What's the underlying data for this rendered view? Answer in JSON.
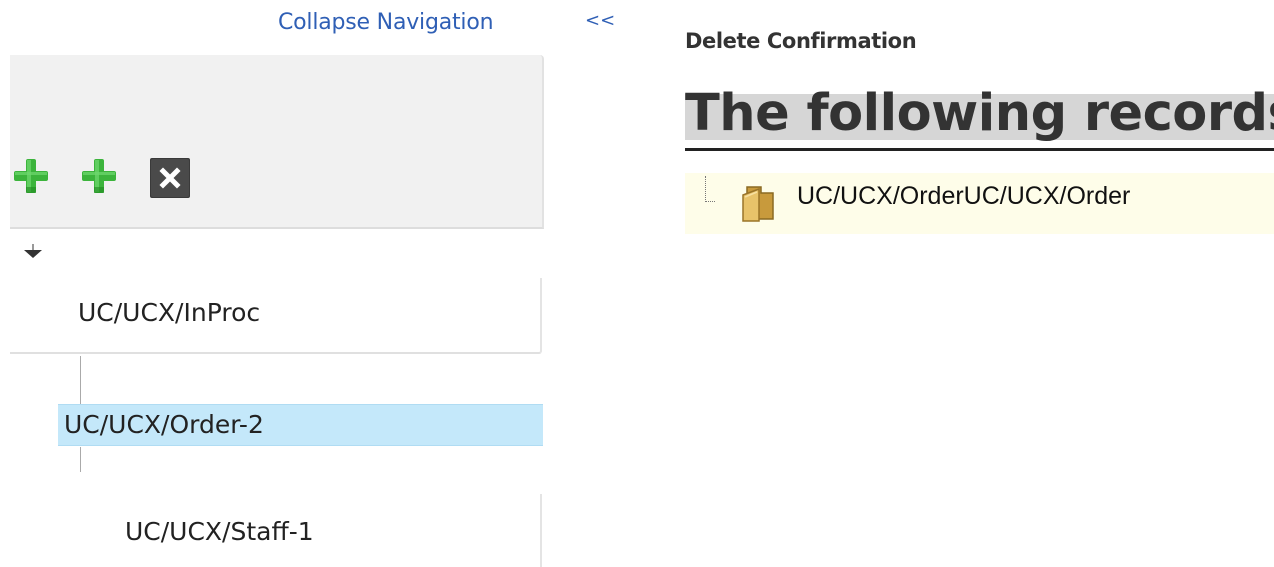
{
  "navigation": {
    "collapse_label": "Collapse Navigation",
    "collapse_arrows": "<<"
  },
  "toolbar": {
    "icons": [
      "add-child-icon",
      "add-sibling-icon",
      "delete-icon"
    ]
  },
  "tree": {
    "nodes": [
      {
        "label": "UC/UCX/InProc"
      },
      {
        "label": "UC/UCX/Order-2",
        "selected": true
      },
      {
        "label": "UC/UCX/Staff-1"
      }
    ]
  },
  "confirmation": {
    "header": "Delete Confirmation",
    "title": "The following records",
    "records": [
      {
        "label": "UC/UCX/OrderUC/UCX/Order",
        "icon": "folder-icon"
      }
    ]
  },
  "colors": {
    "link": "#2f5fb5",
    "selected_bg": "#c4e8fa",
    "records_bg": "#fefde9",
    "add_green": "#3cb43c"
  }
}
